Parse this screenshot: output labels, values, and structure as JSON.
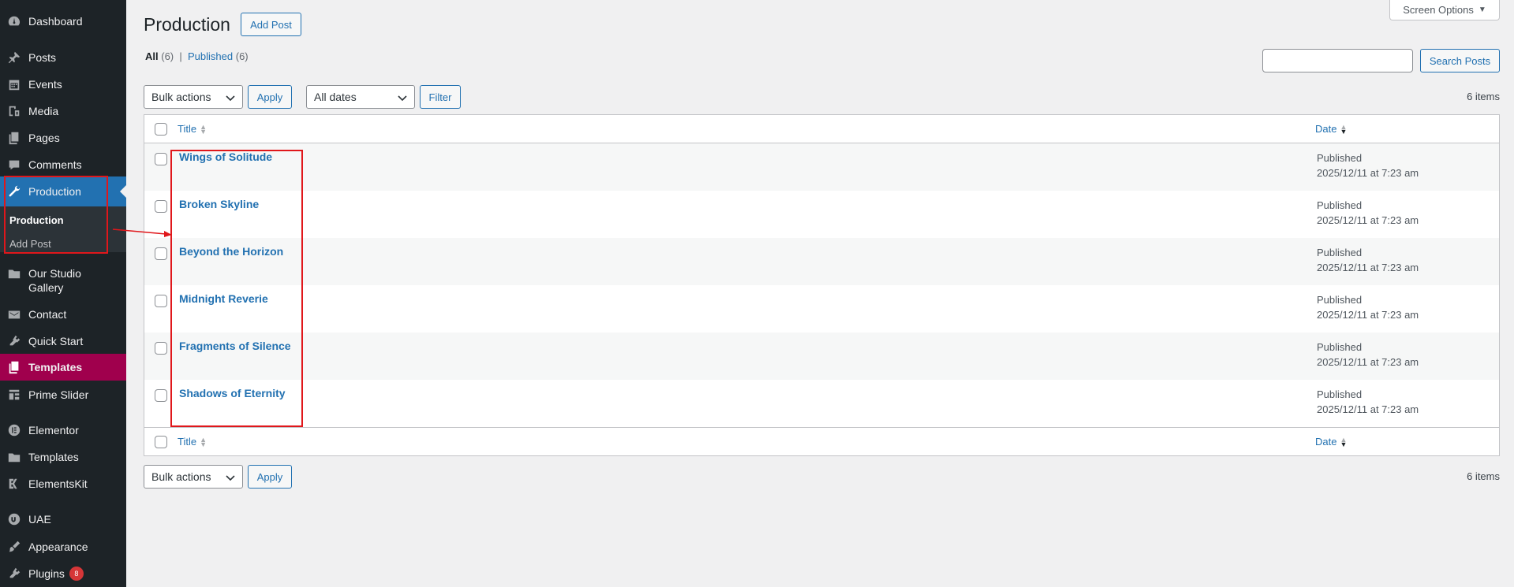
{
  "sidebar": {
    "items": [
      {
        "label": "Dashboard",
        "icon": "dashboard-icon"
      },
      {
        "label": "Posts",
        "icon": "pin-icon"
      },
      {
        "label": "Events",
        "icon": "calendar-icon"
      },
      {
        "label": "Media",
        "icon": "media-icon"
      },
      {
        "label": "Pages",
        "icon": "pages-icon"
      },
      {
        "label": "Comments",
        "icon": "comment-icon"
      },
      {
        "label": "Production",
        "icon": "wrench-icon"
      },
      {
        "label": "Our Studio Gallery",
        "icon": "folder-icon"
      },
      {
        "label": "Contact",
        "icon": "mail-icon"
      },
      {
        "label": "Quick Start",
        "icon": "plug-icon"
      },
      {
        "label": "Templates",
        "icon": "pages-icon"
      },
      {
        "label": "Prime Slider",
        "icon": "slider-icon"
      },
      {
        "label": "Elementor",
        "icon": "elementor-icon"
      },
      {
        "label": "Templates",
        "icon": "folder-icon"
      },
      {
        "label": "ElementsKit",
        "icon": "ek-icon"
      },
      {
        "label": "UAE",
        "icon": "uae-icon"
      },
      {
        "label": "Appearance",
        "icon": "brush-icon"
      },
      {
        "label": "Plugins",
        "icon": "plug-icon",
        "badge": "8"
      }
    ],
    "submenu": [
      {
        "label": "Production"
      },
      {
        "label": "Add Post"
      }
    ]
  },
  "header": {
    "title": "Production",
    "add_post": "Add Post",
    "screen_options": "Screen Options"
  },
  "views": {
    "all": "All",
    "all_count": "(6)",
    "sep": "|",
    "published": "Published",
    "published_count": "(6)"
  },
  "search": {
    "button": "Search Posts"
  },
  "tablenav_top": {
    "bulk_actions": "Bulk actions",
    "apply": "Apply",
    "all_dates": "All dates",
    "filter": "Filter",
    "count": "6 items"
  },
  "tablenav_bottom": {
    "bulk_actions": "Bulk actions",
    "apply": "Apply",
    "count": "6 items"
  },
  "table": {
    "columns": {
      "title": "Title",
      "date": "Date"
    },
    "rows": [
      {
        "title": "Wings of Solitude",
        "status": "Published",
        "date": "2025/12/11 at 7:23 am"
      },
      {
        "title": "Broken Skyline",
        "status": "Published",
        "date": "2025/12/11 at 7:23 am"
      },
      {
        "title": "Beyond the Horizon",
        "status": "Published",
        "date": "2025/12/11 at 7:23 am"
      },
      {
        "title": "Midnight Reverie",
        "status": "Published",
        "date": "2025/12/11 at 7:23 am"
      },
      {
        "title": "Fragments of Silence",
        "status": "Published",
        "date": "2025/12/11 at 7:23 am"
      },
      {
        "title": "Shadows of Eternity",
        "status": "Published",
        "date": "2025/12/11 at 7:23 am"
      }
    ]
  },
  "colors": {
    "sidebar_bg": "#1d2327",
    "accent": "#2271b1",
    "templates_bg": "#a0004d",
    "annotation": "#e0171b"
  }
}
